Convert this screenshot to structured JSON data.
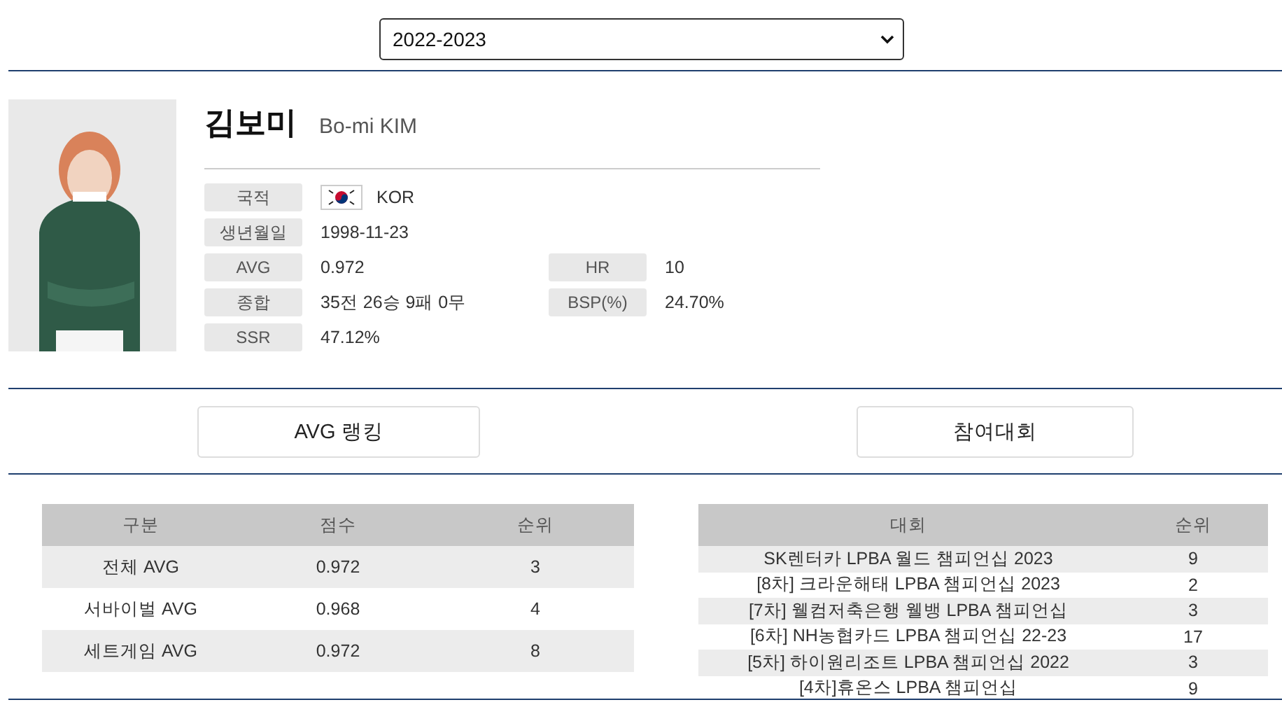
{
  "season_select": {
    "value": "2022-2023"
  },
  "player": {
    "name_ko": "김보미",
    "name_en": "Bo-mi KIM",
    "fields": [
      {
        "label": "국적",
        "value": "KOR",
        "kind": "flag"
      },
      {
        "label": "생년월일",
        "value": "1998-11-23"
      },
      {
        "label": "AVG",
        "value": "0.972",
        "side": {
          "label": "HR",
          "value": "10"
        }
      },
      {
        "label": "종합",
        "value": "35전 26승 9패 0무",
        "side": {
          "label": "BSP(%)",
          "value": "24.70%"
        }
      },
      {
        "label": "SSR",
        "value": "47.12%"
      }
    ]
  },
  "sections": [
    {
      "label": "AVG 랭킹"
    },
    {
      "label": "참여대회"
    }
  ],
  "avg_table": {
    "columns": [
      "구분",
      "점수",
      "순위"
    ],
    "rows": [
      [
        "전체 AVG",
        "0.972",
        "3"
      ],
      [
        "서바이벌 AVG",
        "0.968",
        "4"
      ],
      [
        "세트게임 AVG",
        "0.972",
        "8"
      ]
    ]
  },
  "tournament_table": {
    "columns": [
      "대회",
      "순위"
    ],
    "rows": [
      [
        "SK렌터카 LPBA 월드 챔피언십 2023",
        "9"
      ],
      [
        "[8차] 크라운해태 LPBA 챔피언십 2023",
        "2"
      ],
      [
        "[7차] 웰컴저축은행 웰뱅 LPBA 챔피언십",
        "3"
      ],
      [
        "[6차] NH농협카드 LPBA 챔피언십 22-23",
        "17"
      ],
      [
        "[5차] 하이원리조트 LPBA 챔피언십 2022",
        "3"
      ],
      [
        "[4차]휴온스 LPBA 챔피언십",
        "9"
      ]
    ]
  }
}
